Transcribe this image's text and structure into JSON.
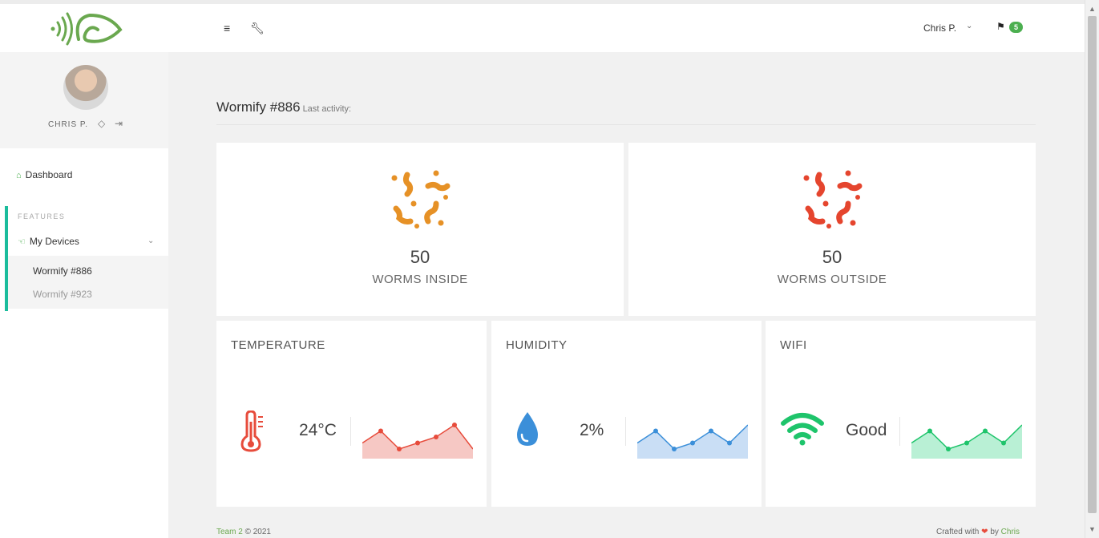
{
  "header": {
    "menu_icon": "hamburger-icon",
    "wrench_icon": "wrench-icon",
    "user_name": "Chris P.",
    "caret": "⌄",
    "flag_icon": "flag-icon",
    "badge": "5"
  },
  "sidebar": {
    "profile": {
      "name": "CHRIS P.",
      "drop_icon": "drop-icon",
      "logout_icon": "logout-icon"
    },
    "dashboard_label": "Dashboard",
    "section_label": "FEATURES",
    "devices_label": "My Devices",
    "devices": [
      {
        "label": "Wormify #886",
        "active": true
      },
      {
        "label": "Wormify #923",
        "active": false
      }
    ]
  },
  "main": {
    "title": "Wormify #886",
    "subtitle": "Last activity:",
    "worms_inside": {
      "value": "50",
      "label": "WORMS INSIDE",
      "color": "#e69126"
    },
    "worms_outside": {
      "value": "50",
      "label": "WORMS OUTSIDE",
      "color": "#e5452e"
    },
    "temperature": {
      "label": "TEMPERATURE",
      "value": "24°C",
      "icon": "thermometer-icon",
      "color": "#e74c3c",
      "fill": "#f6c8c4",
      "trend": [
        3,
        5,
        2,
        3,
        4,
        6,
        2
      ]
    },
    "humidity": {
      "label": "HUMIDITY",
      "value": "2%",
      "icon": "water-drop-icon",
      "color": "#3b8fd9",
      "fill": "#c9def5",
      "trend": [
        4,
        6,
        3,
        4,
        6,
        4,
        7
      ]
    },
    "wifi": {
      "label": "WIFI",
      "value": "Good",
      "icon": "wifi-icon",
      "color": "#1ec46b",
      "fill": "#b9f0d5",
      "trend": [
        4,
        6,
        3,
        4,
        6,
        4,
        7
      ]
    }
  },
  "footer": {
    "team_link": "Team 2",
    "copyright": "© 2021",
    "crafted": "Crafted with",
    "by": "by",
    "author_link": "Chris"
  },
  "colors": {
    "accent": "#1abc9c",
    "brand_green": "#6aa84f"
  }
}
